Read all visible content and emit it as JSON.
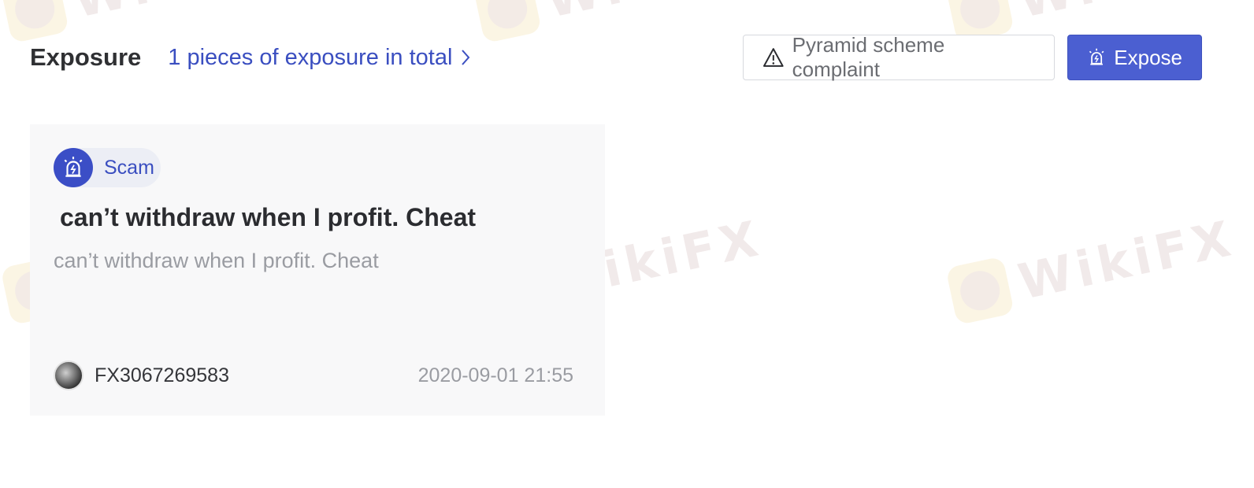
{
  "header": {
    "title": "Exposure",
    "total_link": "1 pieces of exposure in total",
    "complaint_button": "Pyramid scheme complaint",
    "expose_button": "Expose"
  },
  "watermark": {
    "text": "WikiFX"
  },
  "card": {
    "tag_label": "Scam",
    "title": "can’t withdraw when I profit. Cheat",
    "description": "can’t withdraw when I profit. Cheat",
    "username": "FX3067269583",
    "date": "2020-09-01 21:55"
  },
  "icons": {
    "complaint": "warning-icon",
    "expose": "alarm-siren-icon",
    "tag": "alarm-siren-icon",
    "chevron": "chevron-right-icon"
  },
  "colors": {
    "accent": "#3a4ec0",
    "primary_button": "#4b5fd1",
    "card_bg": "#f8f8f9"
  }
}
